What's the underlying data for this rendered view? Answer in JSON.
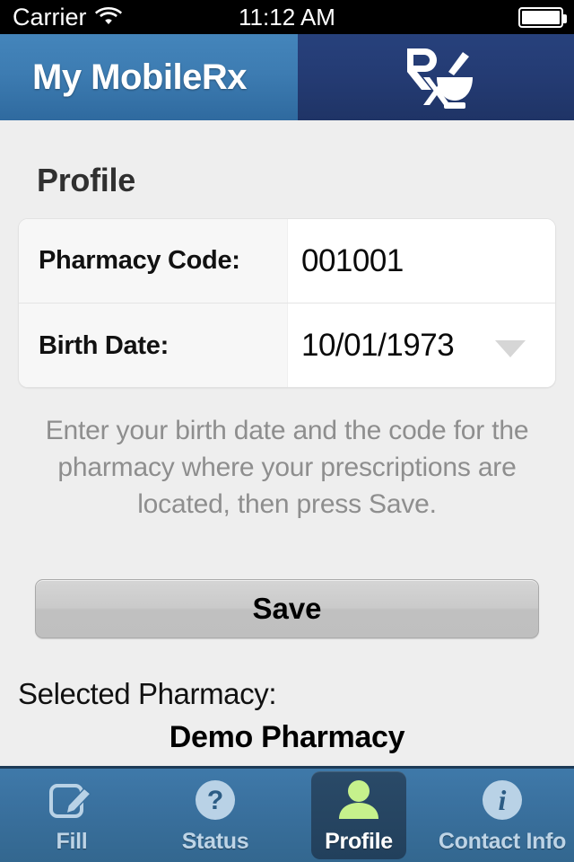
{
  "status_bar": {
    "carrier": "Carrier",
    "wifi_icon": "wifi-icon",
    "time": "11:12 AM",
    "battery_icon": "battery-full-icon"
  },
  "header": {
    "app_title": "My MobileRx",
    "logo_icon": "rx-mortar-pestle-icon",
    "left_panel_color": "#3d7cb2",
    "right_panel_color": "#243b73"
  },
  "main": {
    "page_title": "Profile",
    "form": {
      "rows": [
        {
          "label": "Pharmacy Code:",
          "value": "001001",
          "has_caret": false
        },
        {
          "label": "Birth Date:",
          "value": "10/01/1973",
          "has_caret": true
        }
      ]
    },
    "hint_text": "Enter your birth date and the code for the pharmacy where your prescriptions are located, then press Save.",
    "save_label": "Save",
    "selected_pharmacy_label": "Selected Pharmacy:",
    "selected_pharmacy_value": "Demo Pharmacy"
  },
  "tabbar": {
    "active_index": 2,
    "active_icon_color": "#c6f18c",
    "tabs": [
      {
        "label": "Fill",
        "icon": "compose-pencil-icon"
      },
      {
        "label": "Status",
        "icon": "question-mark-circle-icon"
      },
      {
        "label": "Profile",
        "icon": "person-icon"
      },
      {
        "label": "Contact Info",
        "icon": "info-circle-icon"
      }
    ]
  }
}
